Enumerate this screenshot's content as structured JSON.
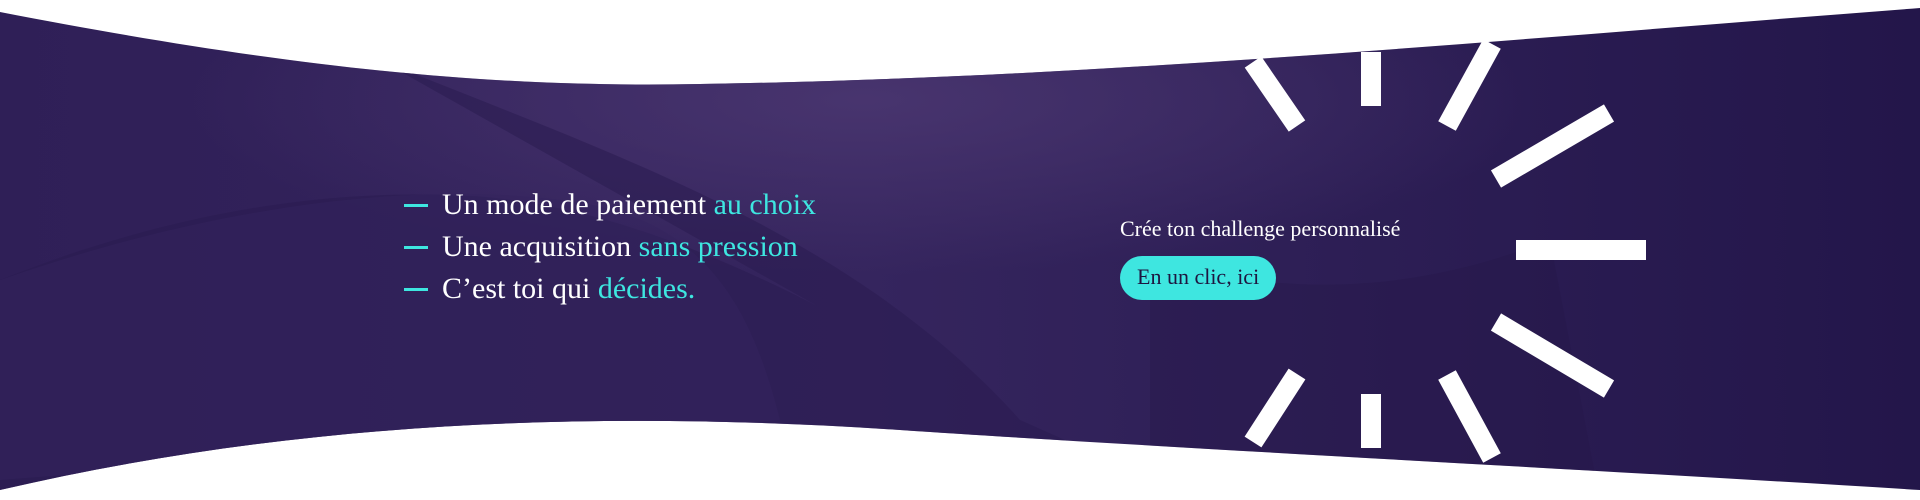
{
  "features": [
    {
      "text": "Un mode de paiement ",
      "accent": "au choix"
    },
    {
      "text": "Une acquisition ",
      "accent": "sans pression"
    },
    {
      "text": "C’est toi qui ",
      "accent": "décides."
    }
  ],
  "cta": {
    "text": "Crée ton challenge personnalisé",
    "button_label": "En un clic, ici"
  },
  "colors": {
    "background": "#2e1e55",
    "accent": "#3ee6e0",
    "text": "#ffffff"
  },
  "icons": [
    "dash-icon",
    "sunburst-icon"
  ]
}
